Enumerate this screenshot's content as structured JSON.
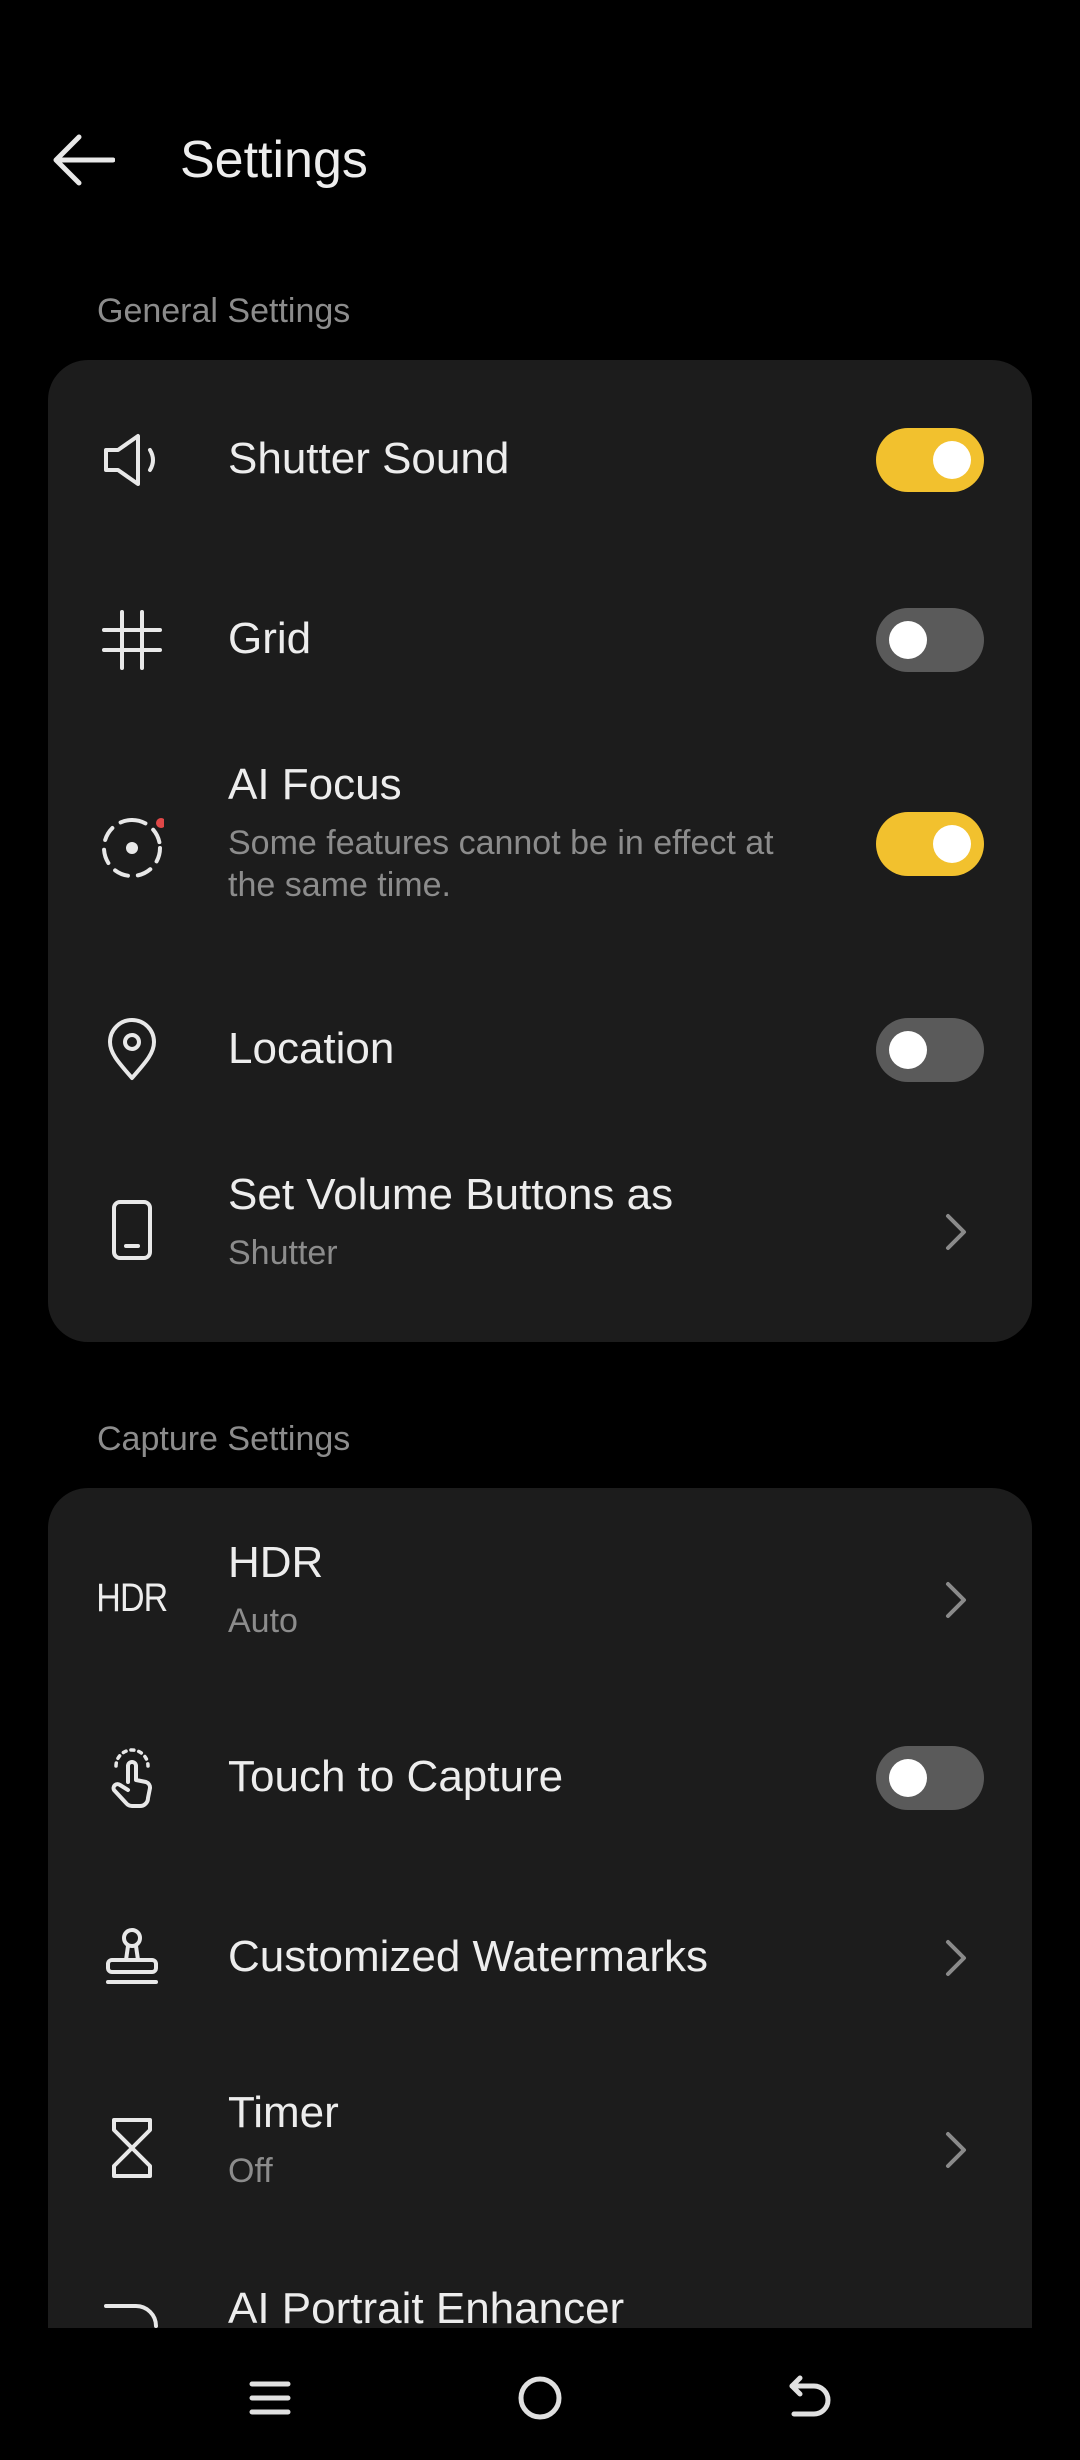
{
  "header": {
    "title": "Settings"
  },
  "general": {
    "label": "General Settings",
    "shutter_sound": {
      "title": "Shutter Sound",
      "on": true
    },
    "grid": {
      "title": "Grid",
      "on": false
    },
    "ai_focus": {
      "title": "AI Focus",
      "subtitle_line1": "Some features cannot be in effect at",
      "subtitle_line2": "the same time.",
      "on": true
    },
    "location": {
      "title": "Location",
      "on": false
    },
    "volume_buttons": {
      "title": "Set Volume Buttons as",
      "value": "Shutter"
    }
  },
  "capture": {
    "label": "Capture Settings",
    "hdr": {
      "icon_text": "HDR",
      "title": "HDR",
      "value": "Auto"
    },
    "touch_capture": {
      "title": "Touch to Capture",
      "on": false
    },
    "watermarks": {
      "title": "Customized Watermarks"
    },
    "timer": {
      "title": "Timer",
      "value": "Off"
    },
    "portrait_enhancer": {
      "title": "AI Portrait Enhancer"
    }
  },
  "colors": {
    "accent": "#f2c12e",
    "card": "#1c1c1c",
    "background": "#000000",
    "toggle_off": "#5a5a5a",
    "dot": "#e04848"
  }
}
